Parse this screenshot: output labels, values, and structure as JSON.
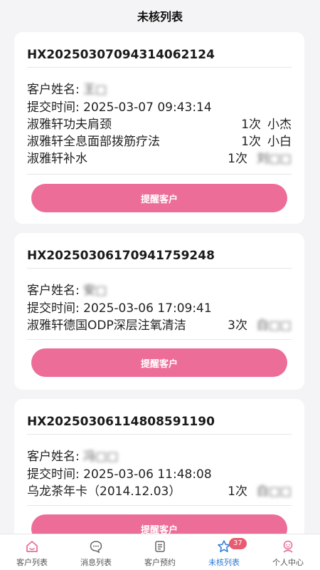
{
  "header": {
    "title": "未核列表"
  },
  "orders": [
    {
      "order_no": "HX20250307094314062124",
      "customer_label": "客户姓名:",
      "customer_name": "王□",
      "time_label": "提交时间:",
      "time": "2025-03-07 09:43:14",
      "services": [
        {
          "name": "淑雅轩功夫肩颈",
          "count": "1次",
          "staff": "小杰"
        },
        {
          "name": "淑雅轩全息面部拨筋疗法",
          "count": "1次",
          "staff": "小白"
        },
        {
          "name": "淑雅轩补水",
          "count": "1次",
          "staff": "刘□□"
        }
      ],
      "button": "提醒客户"
    },
    {
      "order_no": "HX20250306170941759248",
      "customer_label": "客户姓名:",
      "customer_name": "安□",
      "time_label": "提交时间:",
      "time": "2025-03-06 17:09:41",
      "services": [
        {
          "name": "淑雅轩德国ODP深层注氧清洁",
          "count": "3次",
          "staff": "白□□"
        }
      ],
      "button": "提醒客户"
    },
    {
      "order_no": "HX20250306114808591190",
      "customer_label": "客户姓名:",
      "customer_name": "冯□□",
      "time_label": "提交时间:",
      "time": "2025-03-06 11:48:08",
      "services": [
        {
          "name": "乌龙茶年卡（2014.12.03）",
          "count": "1次",
          "staff": "白□□"
        }
      ],
      "button": "提醒客户"
    }
  ],
  "tabbar": {
    "items": [
      {
        "label": "客户列表",
        "icon": "home-icon"
      },
      {
        "label": "消息列表",
        "icon": "message-icon"
      },
      {
        "label": "客户预约",
        "icon": "calendar-list-icon"
      },
      {
        "label": "未核列表",
        "icon": "star-icon",
        "badge": "37",
        "active": true
      },
      {
        "label": "个人中心",
        "icon": "user-icon"
      }
    ]
  },
  "colors": {
    "accent_pink": "#ec6d98",
    "active_blue": "#2a7bd6",
    "badge_red": "#e85b70"
  }
}
